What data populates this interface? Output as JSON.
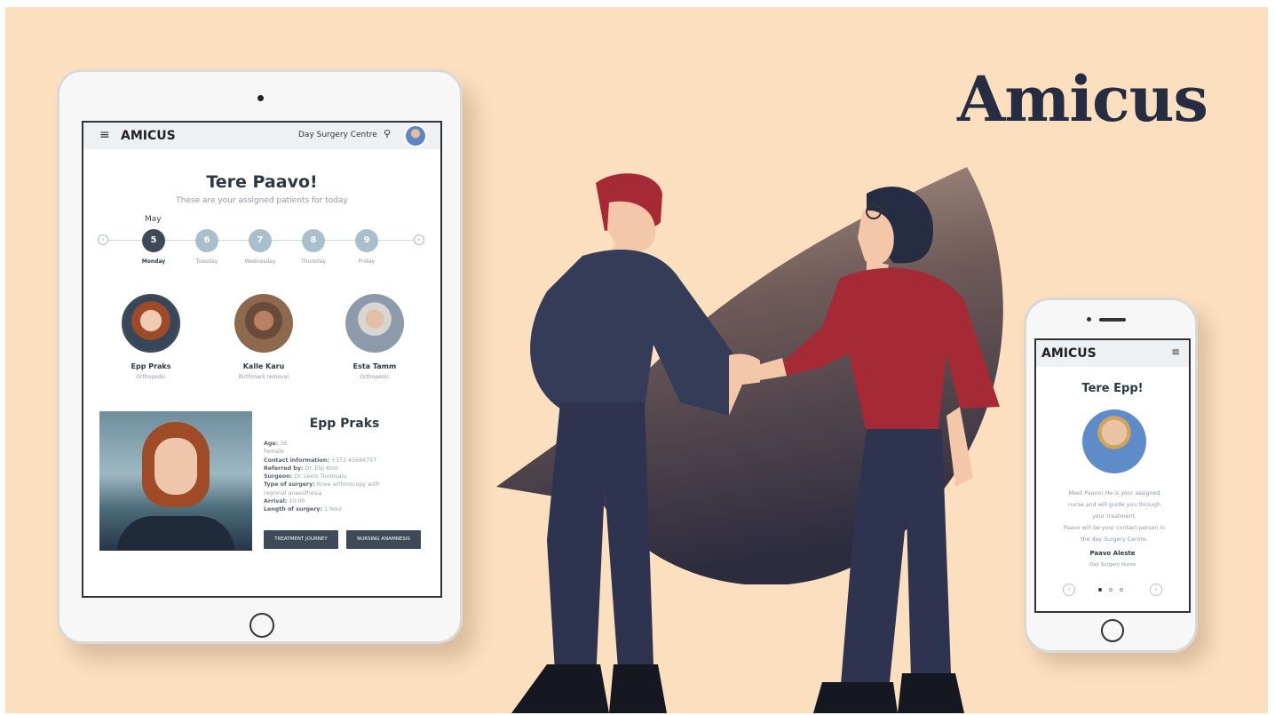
{
  "brand": "Amicus",
  "tablet": {
    "logo": "AMICUS",
    "location": "Day Surgery Centre",
    "greeting": "Tere Paavo!",
    "subtitle": "These are your assigned patients for today",
    "month": "May",
    "days": [
      {
        "num": "5",
        "name": "Monday"
      },
      {
        "num": "6",
        "name": "Tuesday"
      },
      {
        "num": "7",
        "name": "Wednesday"
      },
      {
        "num": "8",
        "name": "Thursday"
      },
      {
        "num": "9",
        "name": "Friday"
      }
    ],
    "patients": [
      {
        "name": "Epp Praks",
        "procedure": "Orthopedic"
      },
      {
        "name": "Kalle Karu",
        "procedure": "Birthmark removal"
      },
      {
        "name": "Esta Tamm",
        "procedure": "Orthopedic"
      }
    ],
    "detail": {
      "name": "Epp Praks",
      "age_label": "Age:",
      "age": "36",
      "pronoun": "Female",
      "contact_label": "Contact information:",
      "contact": "+372 45684757",
      "referred_label": "Referred by:",
      "referred": "Dr. Elsi Koor",
      "surgeon_label": "Surgeon:",
      "surgeon": "Dr. Leelo Toomsalu",
      "type_label": "Type of surgery:",
      "type": "Knee arthroscopy with regional anaesthesia",
      "arrival_label": "Arrival:",
      "arrival": "10:00",
      "length_label": "Length of surgery:",
      "length": "1 hour",
      "btn_journey": "TREATMENT JOURNEY",
      "btn_anamnesis": "NURSING ANAMNESIS"
    }
  },
  "phone": {
    "logo": "AMICUS",
    "greeting": "Tere Epp!",
    "message_lines": [
      "Meet Paavo! He is your assigned",
      "nurse and will guide you through",
      "your treatment.",
      "Paavo will be your contact person in",
      "the day Surgery Centre."
    ],
    "nurse_name": "Paavo Aleste",
    "nurse_role": "Day Surgery Nurse"
  },
  "colors": {
    "background": "#fbdfbf",
    "navy": "#2c3845",
    "red": "#a52a35",
    "accent": "#a9bfcc"
  }
}
